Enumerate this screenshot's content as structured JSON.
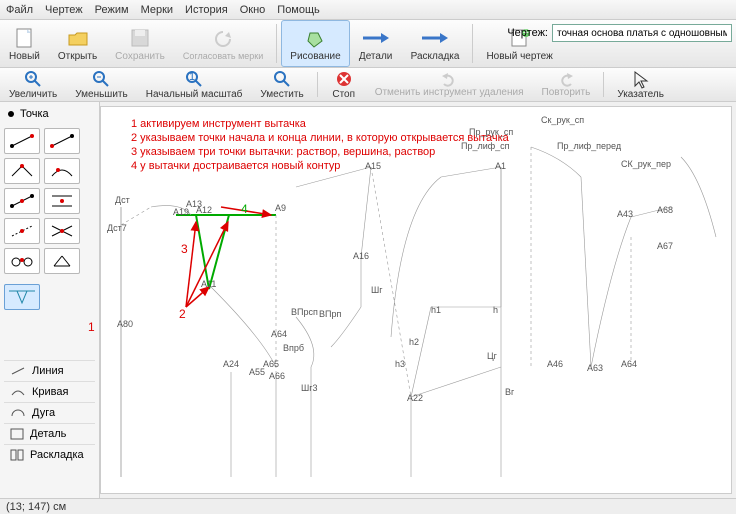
{
  "menu": {
    "items": [
      "Файл",
      "Чертеж",
      "Режим",
      "Мерки",
      "История",
      "Окно",
      "Помощь"
    ]
  },
  "toolbar1": {
    "new": "Новый",
    "open": "Открыть",
    "save": "Сохранить",
    "agree": "Согласовать мерки",
    "drawing": "Рисование",
    "details": "Детали",
    "layout": "Раскладка",
    "newdraw": "Новый чертеж",
    "drawlabel": "Чертеж:",
    "drawname": "точная основа платья с одношовным рука"
  },
  "toolbar2": {
    "zoomin": "Увеличить",
    "zoomout": "Уменьшить",
    "zoomfit": "Начальный масштаб",
    "fit": "Уместить",
    "stop": "Стоп",
    "undo": "Отменить инструмент удаления",
    "redo": "Повторить",
    "pointer": "Указатель"
  },
  "left": {
    "point": "Точка",
    "panels": [
      "Линия",
      "Кривая",
      "Дуга",
      "Деталь",
      "Раскладка"
    ]
  },
  "annotations": {
    "l1": "1 активируем инструмент вытачка",
    "l2": "2 указываем точки начала и конца линии, в которую открывается вытачка",
    "l3": "3 указываем три точки вытачки: раствор, вершина, раствор",
    "l4": "4 у вытачки достраивается новый контур",
    "side1": "1",
    "side2": "2",
    "side3": "3",
    "side4": "4"
  },
  "points": {
    "Дст": "Дст",
    "Дст7": "Дст7",
    "А80": "А80",
    "А24": "А24",
    "А12": "А12",
    "А13": "А13",
    "А19": "А19",
    "А11": "А11",
    "А9": "А9",
    "А65": "А65",
    "А55": "А55",
    "А66": "А66",
    "А64": "А64",
    "Шг3": "Шг3",
    "Впрб": "Впрб",
    "ВПрсп": "ВПрсп",
    "ВПрп": "ВПрп",
    "А15": "А15",
    "А16": "А16",
    "Шг": "Шг",
    "h1": "h1",
    "h2": "h2",
    "h3": "h3",
    "h": "h",
    "А1": "А1",
    "Цг": "Цг",
    "А22": "А22",
    "Вг": "Вг",
    "А46": "А46",
    "А63": "А63",
    "А64b": "А64",
    "А43": "А43",
    "А68": "А68",
    "А67": "А67",
    "Ск_рук_сп": "Ск_рук_сп",
    "Пр_рук_сп": "Пр_рук_сп",
    "Пр_лиф_сп": "Пр_лиф_сп",
    "Пр_лиф_перед": "Пр_лиф_перед",
    "СК_рук_пер": "СК_рук_пер"
  },
  "status": "(13; 147) см"
}
